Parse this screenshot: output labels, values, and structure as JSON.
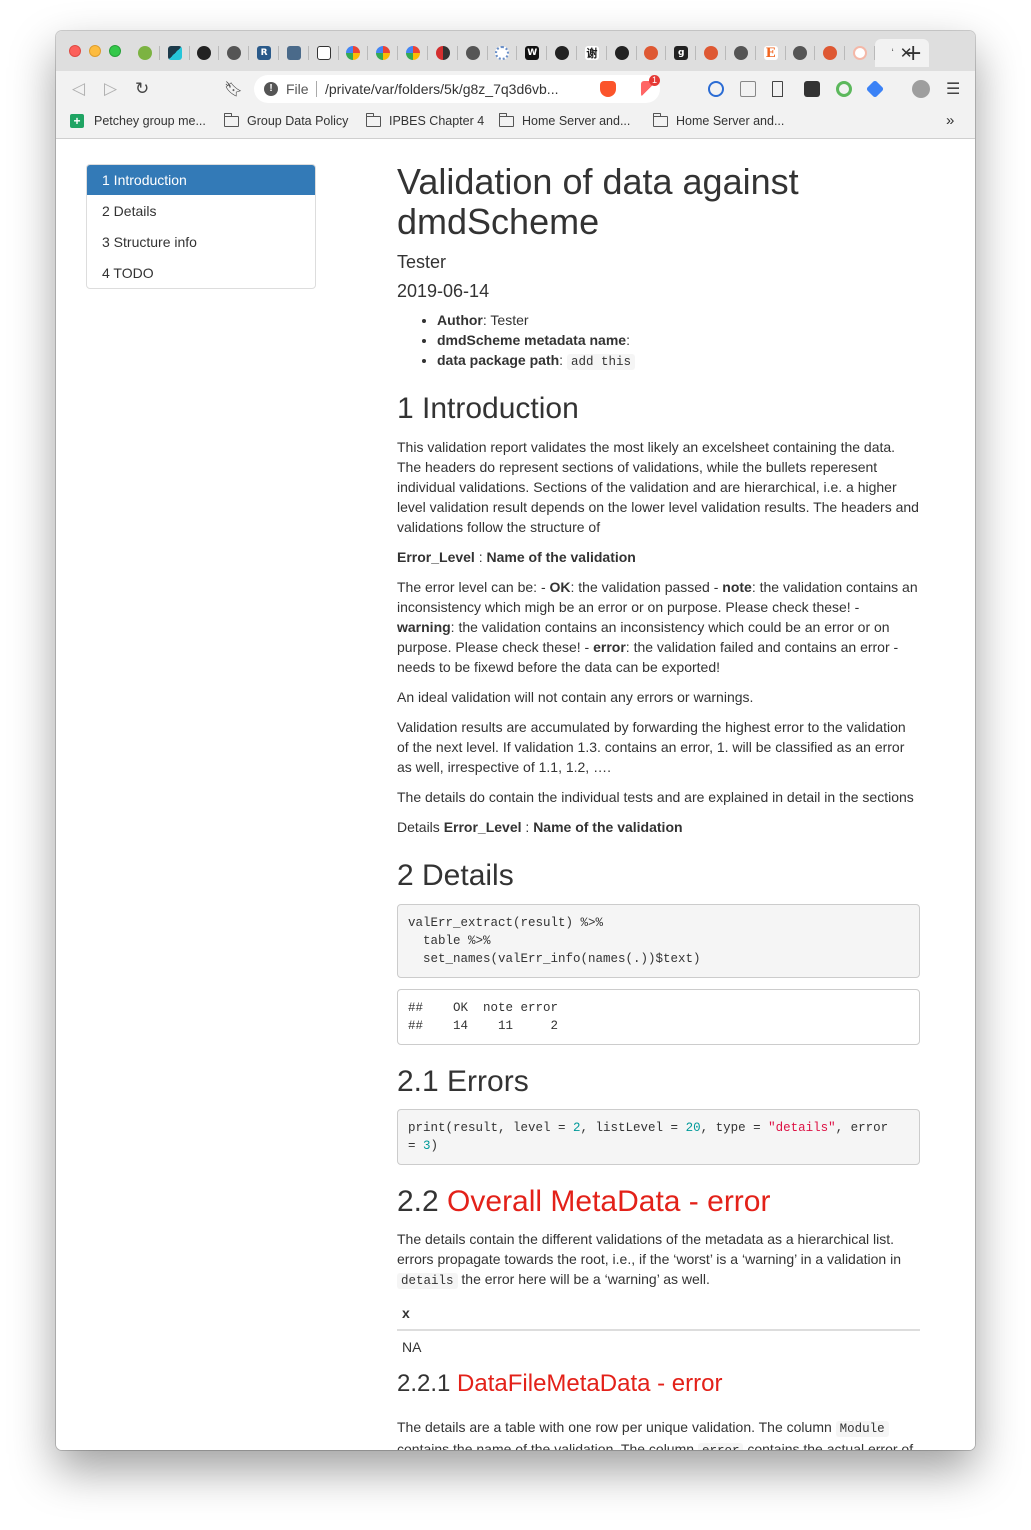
{
  "browser": {
    "url_scheme": "File",
    "url": "/private/var/folders/5k/g8z_7q3d6vb...",
    "new_tab": "+",
    "tab_close": "✕",
    "tab_active_title": "‘",
    "extension_badge": "1",
    "bookmarks": [
      {
        "label": "Petchey group me..."
      },
      {
        "label": "Group Data Policy"
      },
      {
        "label": "IPBES Chapter 4"
      },
      {
        "label": "Home Server and..."
      },
      {
        "label": "Home Server and..."
      }
    ],
    "bookmarks_more": "»",
    "tab_favicons": [
      "green-leaf",
      "kite",
      "github",
      "globe",
      "r-logo",
      "tdwg",
      "unknown",
      "google-photos",
      "google-photos",
      "google-photos",
      "slides",
      "globe",
      "nodes",
      "wikipedia",
      "github",
      "xie",
      "github",
      "duckduckgo",
      "g-letter",
      "duckduckgo",
      "globe",
      "etsy",
      "globe",
      "duckduckgo",
      "loading"
    ]
  },
  "toc": {
    "items": [
      "1 Introduction",
      "2 Details",
      "3 Structure info",
      "4 TODO"
    ],
    "active_index": 0
  },
  "doc": {
    "title": "Validation of data against dmdScheme",
    "author": "Tester",
    "date": "2019-06-14",
    "meta": {
      "author_label": "Author",
      "author_value": ": Tester",
      "name_label": "dmdScheme metadata name",
      "name_value": ":",
      "path_label": "data package path",
      "path_value": ": ",
      "path_code": "add this"
    },
    "intro": {
      "heading": "1 Introduction",
      "p1": "This validation report validates the most likely an excelsheet containing the data. The headers do represent sections of validations, while the bullets reperesent individual validations. Sections of the validation and are hierarchical, i.e. a higher level validation result depends on the lower level validation results. The headers and validations follow the structure of",
      "p2_bold1": "Error_Level",
      "p2_sep": " : ",
      "p2_bold2": "Name of the validation",
      "p3_a": "The error level can be: - ",
      "p3_ok": "OK",
      "p3_b": ": the validation passed - ",
      "p3_note": "note",
      "p3_c": ": the validation contains an inconsistency which migh be an error or on purpose. Please check these! - ",
      "p3_warning": "warning",
      "p3_d": ": the validation contains an inconsistency which could be an error or on purpose. Please check these! - ",
      "p3_error": "error",
      "p3_e": ": the validation failed and contains an error - needs to be fixewd before the data can be exported!",
      "p4": "An ideal validation will not contain any errors or warnings.",
      "p5": "Validation results are accumulated by forwarding the highest error to the validation of the next level. If validation 1.3. contains an error, 1. will be classified as an error as well, irrespective of 1.1, 1.2, ….",
      "p6": "The details do contain the individual tests and are explained in detail in the sections",
      "p7_pre": "Details ",
      "p7_bold1": "Error_Level",
      "p7_sep": " : ",
      "p7_bold2": "Name of the validation"
    },
    "details": {
      "heading": "2 Details",
      "code_line1": "valErr_extract(result) %>%",
      "code_line2": "  table %>%",
      "code_line3": "  set_names(valErr_info(names(.))$text)",
      "out_line1": "##    OK  note error",
      "out_line2": "##    14    11     2"
    },
    "errors": {
      "heading": "2.1 Errors",
      "code_a": "print(result, level = ",
      "code_n1": "2",
      "code_b": ", listLevel = ",
      "code_n2": "20",
      "code_c": ", type = ",
      "code_s": "\"details\"",
      "code_d": ", error ",
      "code_e": "= ",
      "code_n3": "3",
      "code_f": ")"
    },
    "overall": {
      "heading_num": "2.2 ",
      "heading_text": "Overall MetaData - error",
      "p1": "The details contain the different validations of the metadata as a hierarchical list. errors propagate towards the root, i.e., if the ‘worst’ is a ‘warning’ in a validation in",
      "p1_code": "details",
      "p1_end": " the error here will be a ‘warning’ as well.",
      "table_header": "x",
      "table_value": "NA"
    },
    "datafile": {
      "heading_num": "2.2.1 ",
      "heading_text": "DataFileMetaData - error",
      "p1_a": "The details are a table with one row per unique validation. The column ",
      "p1_code1": "Module",
      "p1_b": "contains the name of the validation. The column ",
      "p1_code2": "error",
      "p1_c": " contains the actual error of"
    }
  },
  "colors": {
    "toc_active": "#337ab7",
    "error_heading": "#e32119",
    "numbers": "#099",
    "strings": "#d14"
  }
}
